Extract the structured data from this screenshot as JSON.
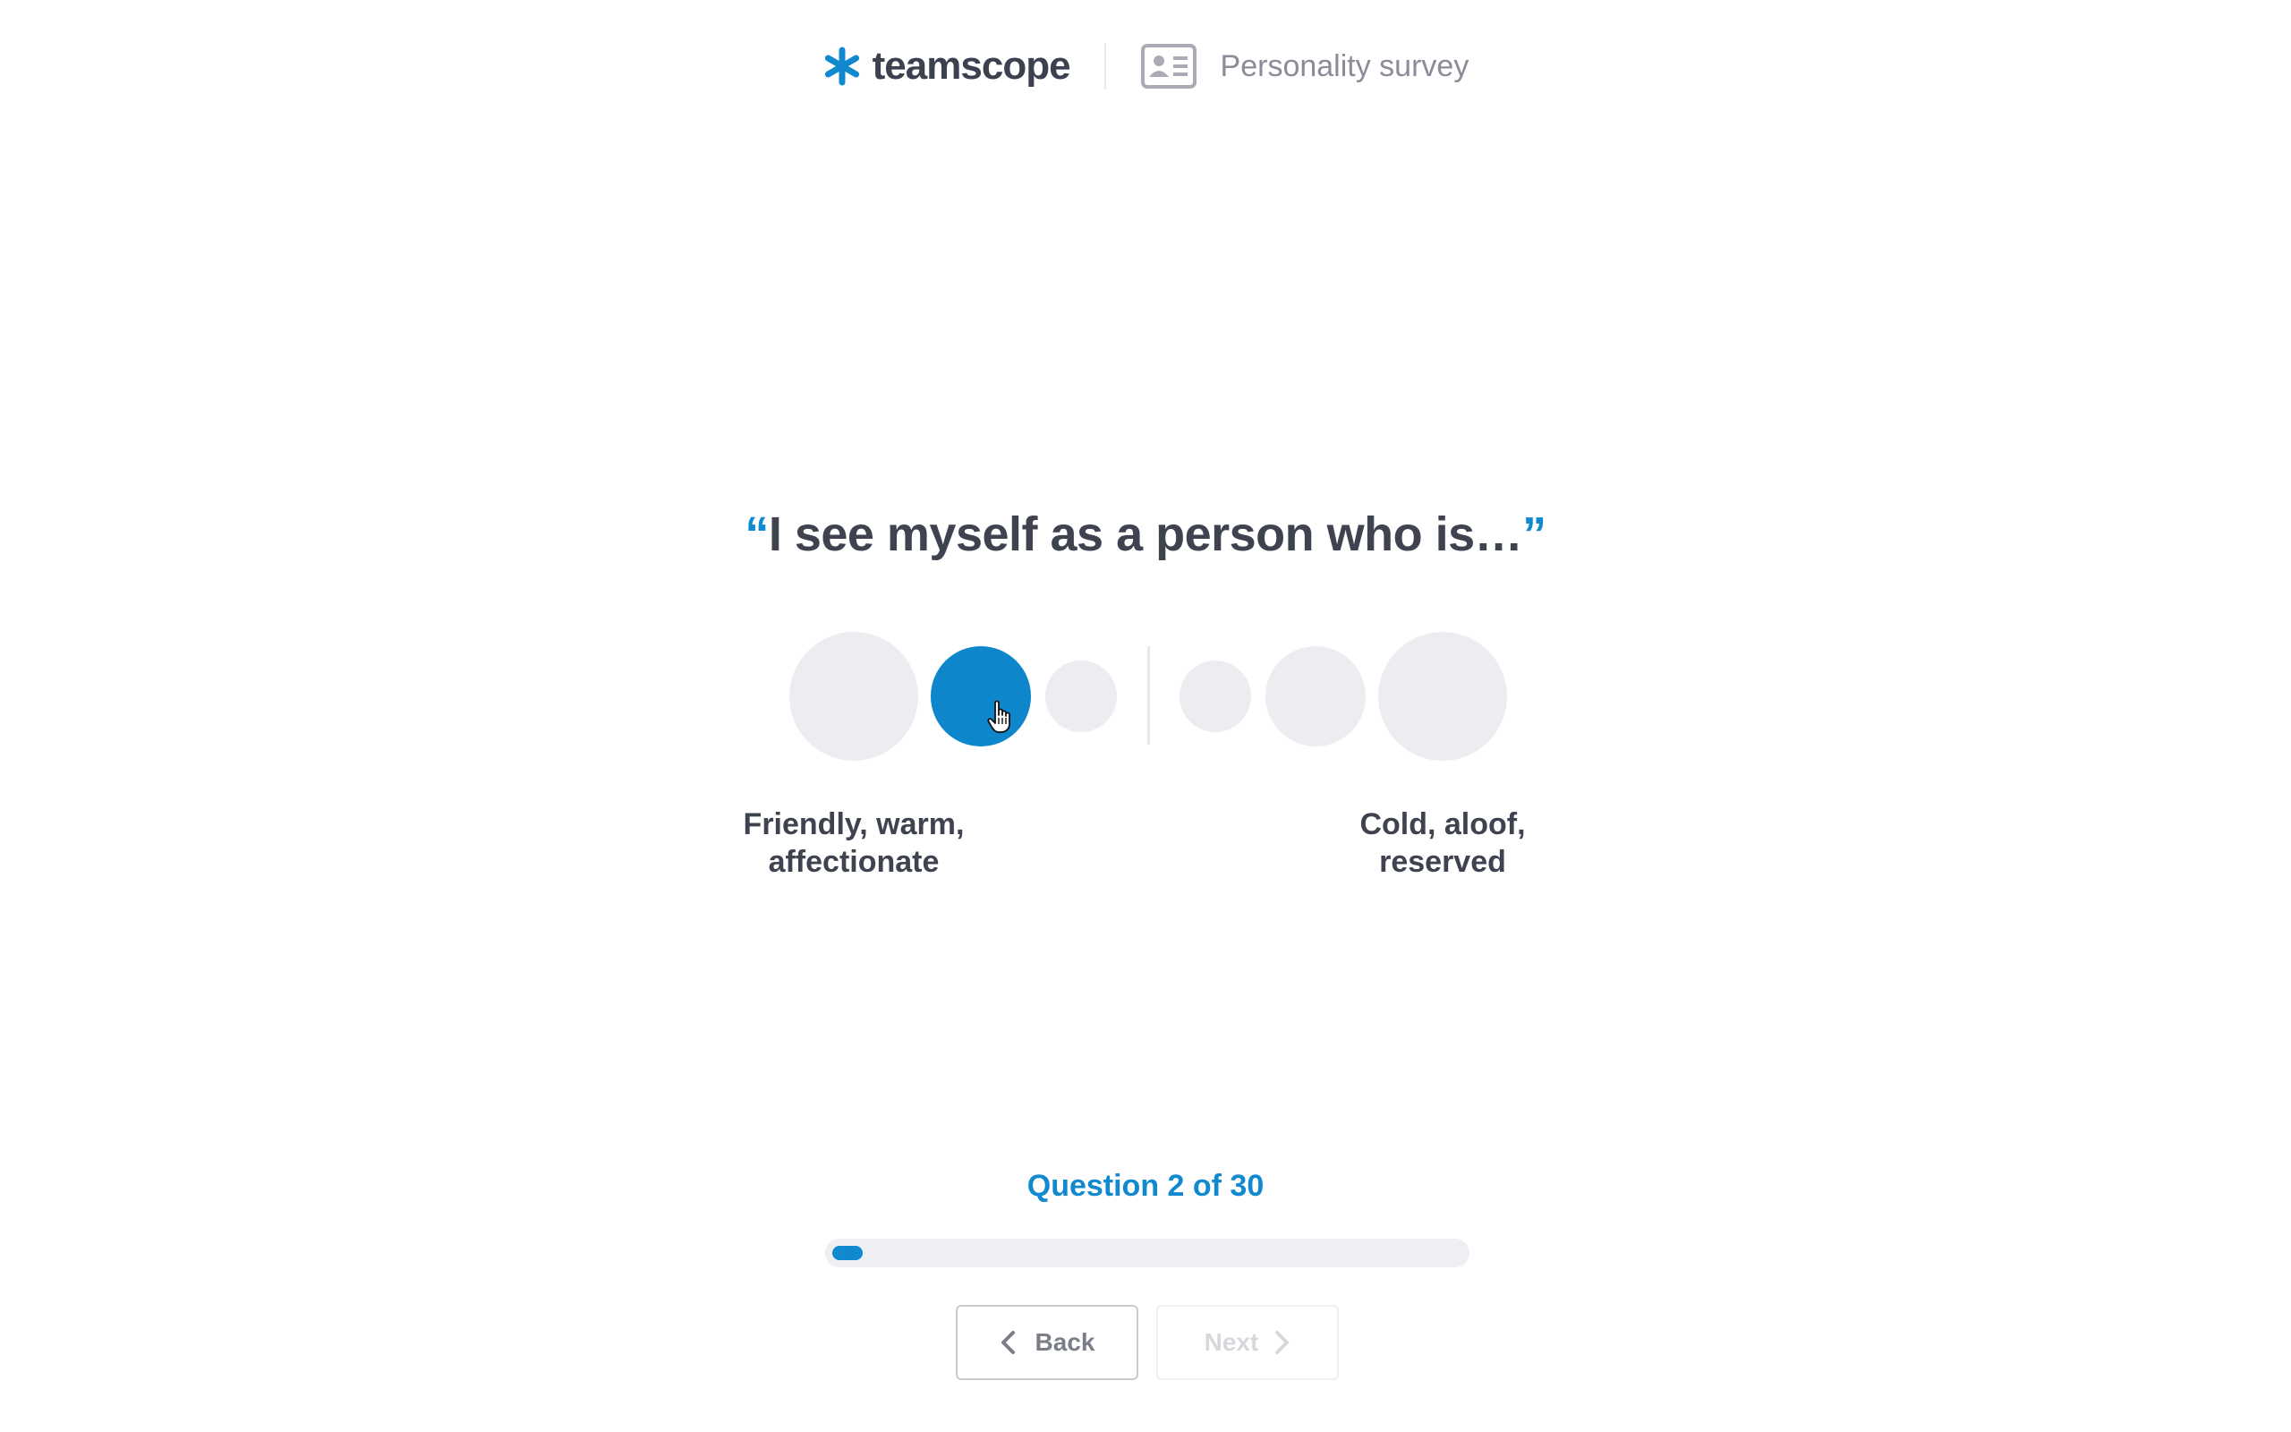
{
  "header": {
    "brand_name": "teamscope",
    "survey_title": "Personality survey",
    "brand_icon": "asterisk-icon",
    "survey_icon": "id-card-icon",
    "accent_color": "#1189cf"
  },
  "question": {
    "open_quote": "“",
    "text": "I see myself as a person who is…",
    "close_quote": "”"
  },
  "scale": {
    "left_label_line1": "Friendly, warm,",
    "left_label_line2": "affectionate",
    "right_label_line1": "Cold, aloof,",
    "right_label_line2": "reserved",
    "options_count": 6,
    "selected_option": 2,
    "selected_color": "#0d86cc",
    "unselected_color": "#ecedf0"
  },
  "progress": {
    "label": "Question 2 of 30",
    "current": 2,
    "total": 30
  },
  "buttons": {
    "back_label": "Back",
    "next_label": "Next",
    "next_enabled": false
  }
}
